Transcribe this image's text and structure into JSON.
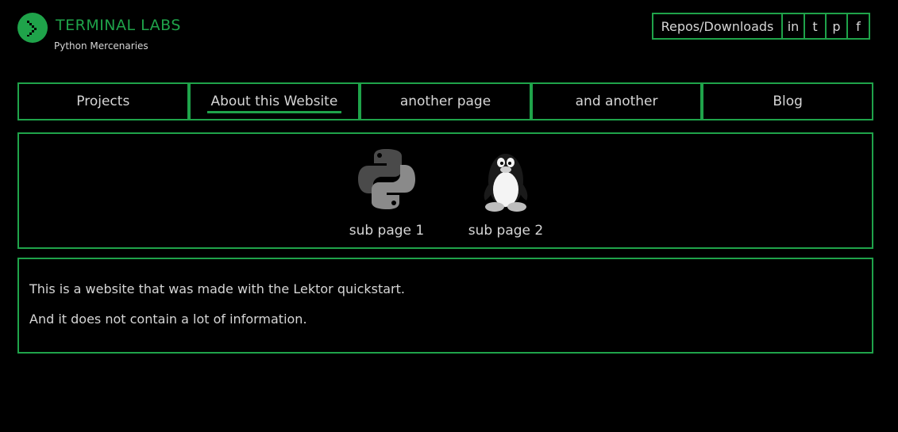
{
  "brand": {
    "title": "TERMINAL LABS",
    "subtitle": "Python Mercenaries",
    "accent": "#1fa34a",
    "logo_icon": "chevron-right-icon"
  },
  "topnav": [
    {
      "label": "Repos/Downloads"
    },
    {
      "label": "in"
    },
    {
      "label": "t"
    },
    {
      "label": "p"
    },
    {
      "label": "f"
    }
  ],
  "mainnav": [
    {
      "label": "Projects",
      "active": false
    },
    {
      "label": "About this Website",
      "active": true
    },
    {
      "label": "another page",
      "active": false
    },
    {
      "label": "and another",
      "active": false
    },
    {
      "label": "Blog",
      "active": false
    }
  ],
  "subpages": [
    {
      "label": "sub page 1",
      "icon": "python-logo-icon"
    },
    {
      "label": "sub page 2",
      "icon": "tux-penguin-icon"
    }
  ],
  "content": {
    "paragraphs": [
      "This is a website that was made with the Lektor quickstart.",
      "And it does not contain a lot of information."
    ]
  }
}
